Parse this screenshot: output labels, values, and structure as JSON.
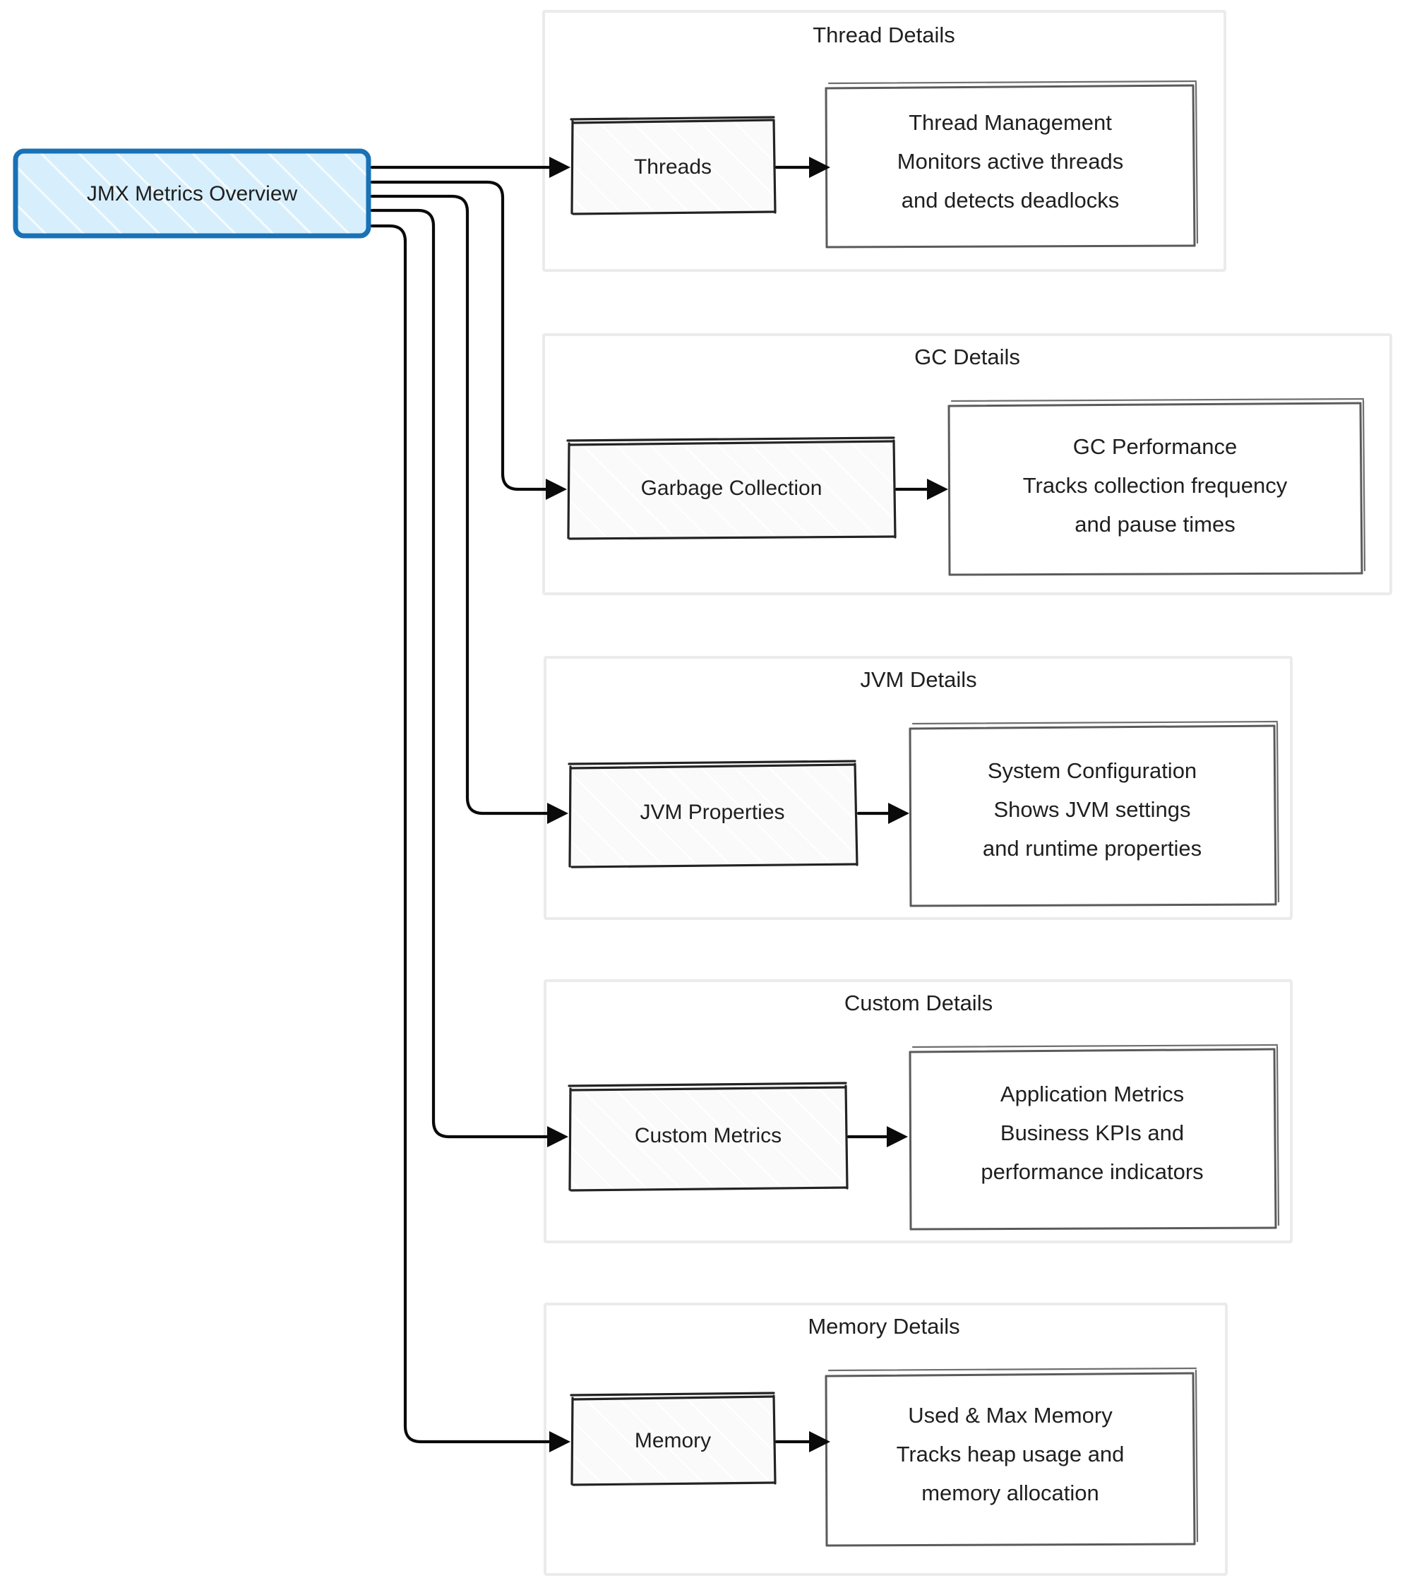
{
  "diagram": {
    "title": "JMX Metrics Overview",
    "type": "flowchart",
    "root_node": {
      "id": "root",
      "label": "JMX Metrics Overview",
      "fill_color": "#d7effc",
      "stroke_color": "#1971b6"
    },
    "clusters": [
      {
        "id": "thread-details",
        "title": "Thread Details",
        "process_node": {
          "id": "threads",
          "label": "Threads"
        },
        "detail_node": {
          "id": "thread-detail",
          "lines": [
            "Thread Management",
            "Monitors active threads",
            "and detects deadlocks"
          ]
        }
      },
      {
        "id": "gc-details",
        "title": "GC Details",
        "process_node": {
          "id": "gc",
          "label": "Garbage Collection"
        },
        "detail_node": {
          "id": "gc-detail",
          "lines": [
            "GC Performance",
            "Tracks collection frequency",
            "and pause times"
          ]
        }
      },
      {
        "id": "jvm-details",
        "title": "JVM Details",
        "process_node": {
          "id": "jvm",
          "label": "JVM Properties"
        },
        "detail_node": {
          "id": "jvm-detail",
          "lines": [
            "System Configuration",
            "Shows JVM settings",
            "and runtime properties"
          ]
        }
      },
      {
        "id": "custom-details",
        "title": "Custom Details",
        "process_node": {
          "id": "custom",
          "label": "Custom Metrics"
        },
        "detail_node": {
          "id": "custom-detail",
          "lines": [
            "Application Metrics",
            "Business KPIs and",
            "performance indicators"
          ]
        }
      },
      {
        "id": "memory-details",
        "title": "Memory Details",
        "process_node": {
          "id": "memory",
          "label": "Memory"
        },
        "detail_node": {
          "id": "memory-detail",
          "lines": [
            "Used & Max Memory",
            "Tracks heap usage and",
            "memory allocation"
          ]
        }
      }
    ],
    "edges": [
      {
        "from": "root",
        "to": "threads"
      },
      {
        "from": "root",
        "to": "gc"
      },
      {
        "from": "root",
        "to": "jvm"
      },
      {
        "from": "root",
        "to": "custom"
      },
      {
        "from": "root",
        "to": "memory"
      },
      {
        "from": "threads",
        "to": "thread-detail"
      },
      {
        "from": "gc",
        "to": "gc-detail"
      },
      {
        "from": "jvm",
        "to": "jvm-detail"
      },
      {
        "from": "custom",
        "to": "custom-detail"
      },
      {
        "from": "memory",
        "to": "memory-detail"
      }
    ]
  }
}
